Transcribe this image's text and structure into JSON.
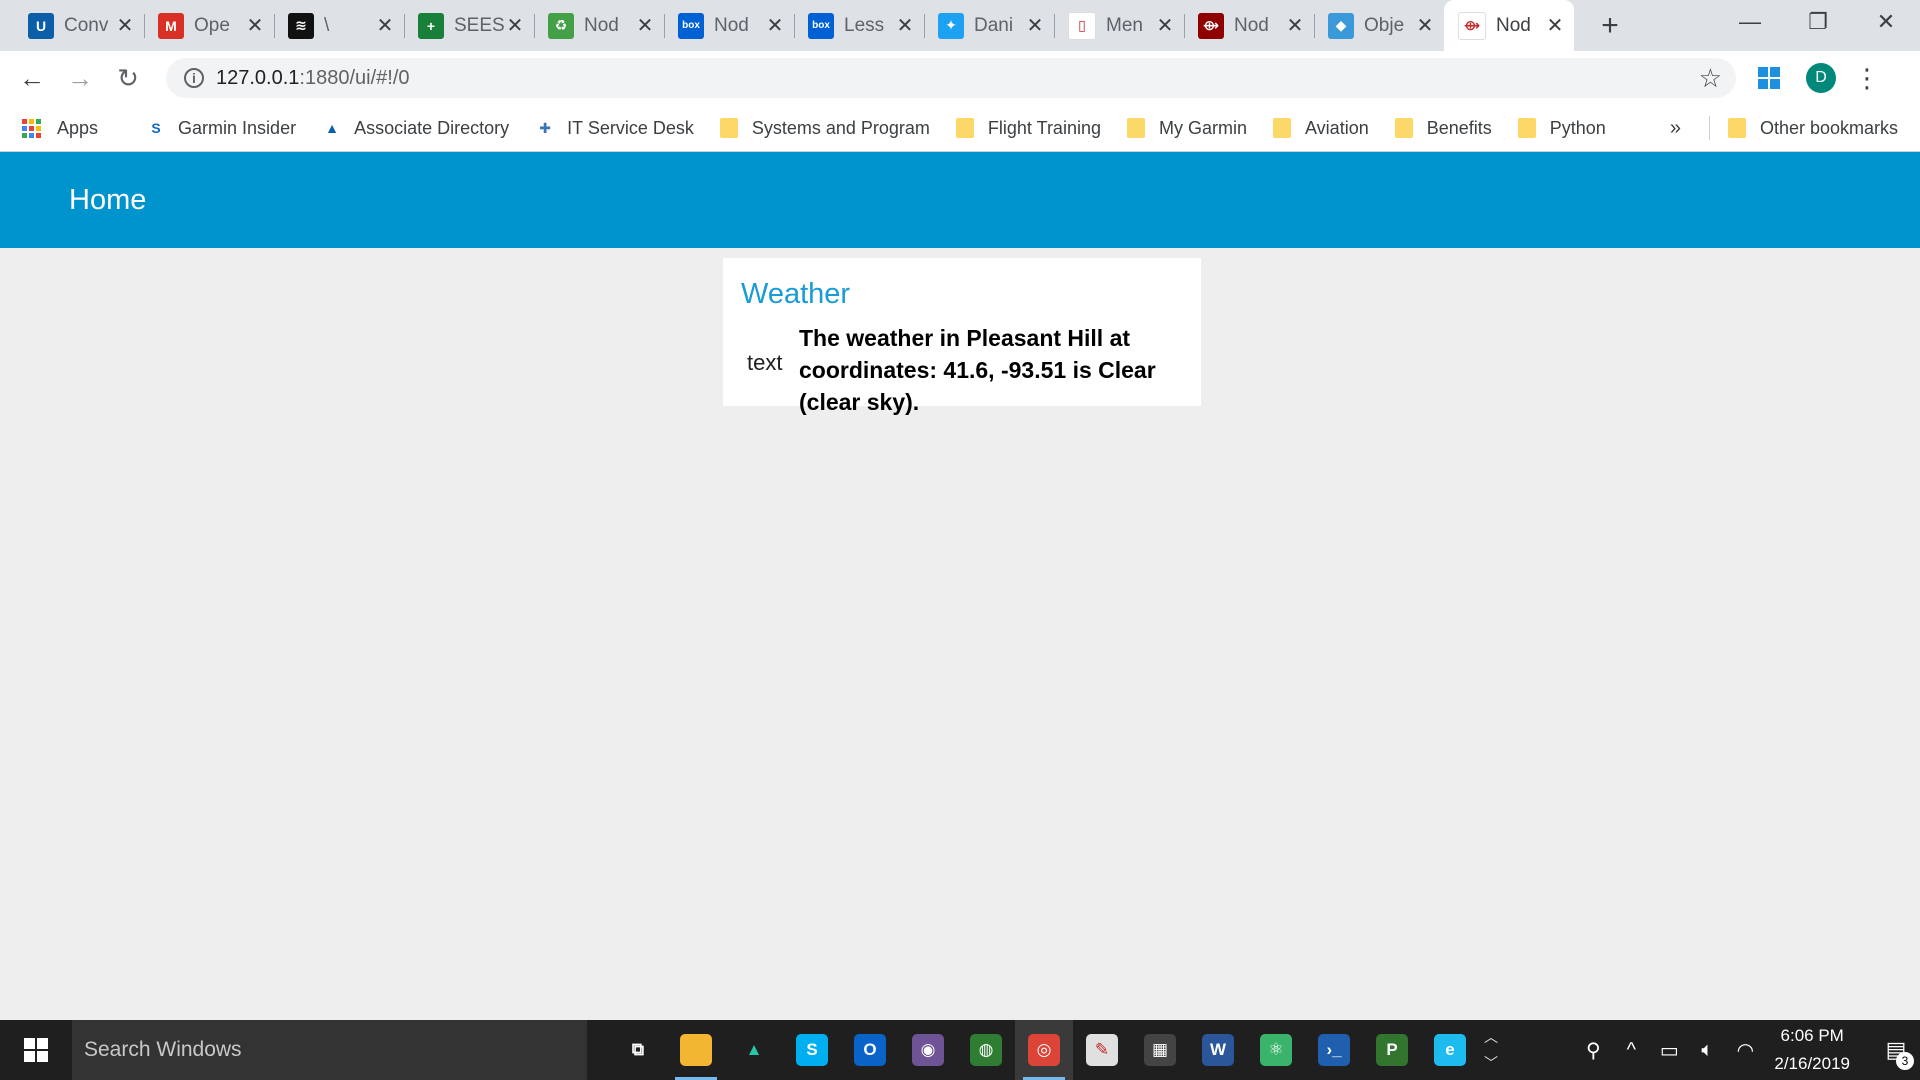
{
  "browser": {
    "tabs": [
      {
        "icon": "umkc-icon",
        "title": "Conv",
        "icon_text": "U",
        "color": "#0b5ea8"
      },
      {
        "icon": "gmail-icon",
        "title": "Ope",
        "icon_text": "M",
        "color": "#d93025"
      },
      {
        "icon": "spotify-icon",
        "title": "\\",
        "icon_text": "≋",
        "color": "#111111"
      },
      {
        "icon": "sheets-icon",
        "title": "SEES",
        "icon_text": "+",
        "color": "#188038"
      },
      {
        "icon": "recycle-icon",
        "title": "Nod",
        "icon_text": "♻",
        "color": "#43a047"
      },
      {
        "icon": "box-icon",
        "title": "Nod",
        "icon_text": "box",
        "color": "#0061d5"
      },
      {
        "icon": "box-icon",
        "title": "Less",
        "icon_text": "box",
        "color": "#0061d5"
      },
      {
        "icon": "twitter-icon",
        "title": "Dani",
        "icon_text": "✦",
        "color": "#1da1f2"
      },
      {
        "icon": "page-icon",
        "title": "Men",
        "icon_text": "▯",
        "color": "#ffffff"
      },
      {
        "icon": "node-red-icon",
        "title": "Nod",
        "icon_text": "⟴",
        "color": "#8f0000"
      },
      {
        "icon": "bird-icon",
        "title": "Obje",
        "icon_text": "◆",
        "color": "#3a9ad9"
      },
      {
        "icon": "node-red-icon",
        "title": "Nod",
        "icon_text": "⟴",
        "color": "#ffffff"
      }
    ],
    "active_tab_index": 11,
    "new_tab": "+",
    "window_controls": {
      "minimize": "—",
      "restore": "❐",
      "close": "✕"
    },
    "url_host": "127.0.0.1",
    "url_path": ":1880/ui/#!/0",
    "profile_initial": "D",
    "bookmarks": [
      {
        "label": "Garmin Insider",
        "icon": "sharepoint-icon",
        "color": "#0f6cbd"
      },
      {
        "label": "Associate Directory",
        "icon": "triangle-icon",
        "color": "#0b5ea8"
      },
      {
        "label": "IT Service Desk",
        "icon": "service-desk-icon",
        "color": "#3b73b9"
      },
      {
        "label": "Systems and Program",
        "icon": "folder-icon"
      },
      {
        "label": "Flight Training",
        "icon": "folder-icon"
      },
      {
        "label": "My Garmin",
        "icon": "folder-icon"
      },
      {
        "label": "Aviation",
        "icon": "folder-icon"
      },
      {
        "label": "Benefits",
        "icon": "folder-icon"
      },
      {
        "label": "Python",
        "icon": "folder-icon"
      }
    ],
    "apps_label": "Apps",
    "more_bookmarks": "»",
    "other_bookmarks": "Other bookmarks"
  },
  "dashboard": {
    "header_title": "Home",
    "card_title": "Weather",
    "row_label": "text",
    "row_value": "The weather in Pleasant Hill at coordinates: 41.6, -93.51 is Clear (clear sky)."
  },
  "taskbar": {
    "search_placeholder": "Search Windows",
    "apps": [
      {
        "name": "task-view-icon",
        "glyph": "⧉",
        "color": "transparent"
      },
      {
        "name": "file-explorer-icon",
        "glyph": "▬",
        "color": "#f2b632"
      },
      {
        "name": "atlas-icon",
        "glyph": "▲",
        "color": "transparent"
      },
      {
        "name": "skype-icon",
        "glyph": "S",
        "color": "#00aff0"
      },
      {
        "name": "outlook-icon",
        "glyph": "O",
        "color": "#0a64c8"
      },
      {
        "name": "github-icon",
        "glyph": "◉",
        "color": "#6e5494"
      },
      {
        "name": "globe-icon",
        "glyph": "◍",
        "color": "#2e7d32"
      },
      {
        "name": "chrome-icon",
        "glyph": "◎",
        "color": "#db4437"
      },
      {
        "name": "paint-icon",
        "glyph": "✎",
        "color": "#e0e0e0"
      },
      {
        "name": "calculator-icon",
        "glyph": "▦",
        "color": "#444444"
      },
      {
        "name": "word-icon",
        "glyph": "W",
        "color": "#2b579a"
      },
      {
        "name": "atom-icon",
        "glyph": "⚛",
        "color": "#3ab46a"
      },
      {
        "name": "powershell-icon",
        "glyph": "›_",
        "color": "#1f5fae"
      },
      {
        "name": "project-icon",
        "glyph": "P",
        "color": "#31752f"
      },
      {
        "name": "ie-icon",
        "glyph": "e",
        "color": "#1ebbee"
      }
    ],
    "time": "6:06 PM",
    "date": "2/16/2019",
    "notification_count": "3"
  }
}
